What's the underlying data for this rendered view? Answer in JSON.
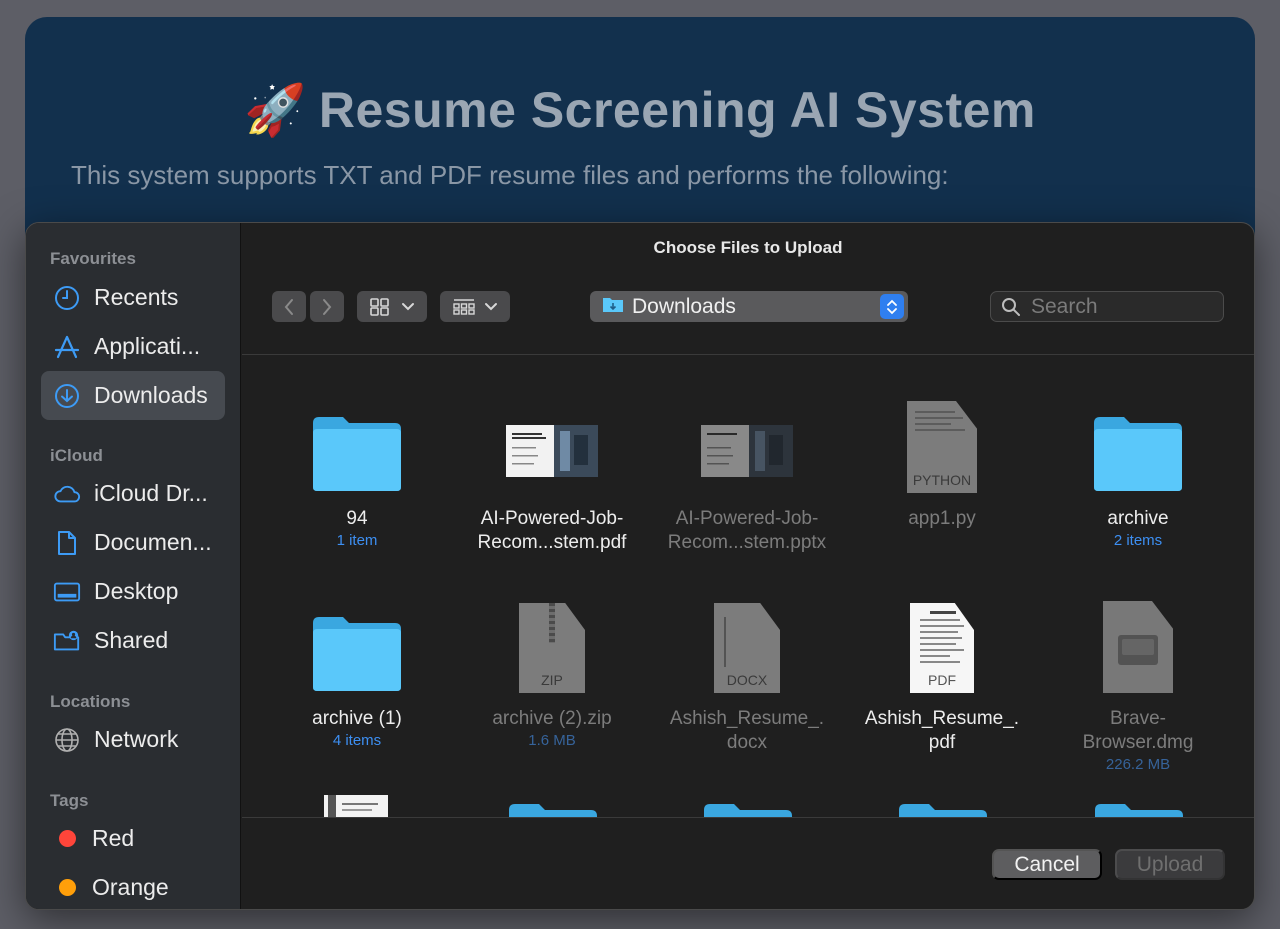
{
  "app": {
    "title": "Resume Screening AI System",
    "title_emoji": "🚀",
    "subtitle": "This system supports TXT and PDF resume files and performs the following:"
  },
  "dialog": {
    "title": "Choose Files to Upload",
    "location": "Downloads",
    "search_placeholder": "Search",
    "cancel_label": "Cancel",
    "upload_label": "Upload"
  },
  "sidebar": {
    "favourites_header": "Favourites",
    "favourites": [
      {
        "label": "Recents",
        "icon": "clock-icon"
      },
      {
        "label": "Applicati...",
        "icon": "applications-icon"
      },
      {
        "label": "Downloads",
        "icon": "download-icon",
        "selected": true
      }
    ],
    "icloud_header": "iCloud",
    "icloud": [
      {
        "label": "iCloud Dr...",
        "icon": "cloud-icon"
      },
      {
        "label": "Documen...",
        "icon": "document-icon"
      },
      {
        "label": "Desktop",
        "icon": "desktop-icon"
      },
      {
        "label": "Shared",
        "icon": "shared-folder-icon"
      }
    ],
    "locations_header": "Locations",
    "locations": [
      {
        "label": "Network",
        "icon": "globe-icon"
      }
    ],
    "tags_header": "Tags",
    "tags": [
      {
        "label": "Red",
        "color": "#ff453a"
      },
      {
        "label": "Orange",
        "color": "#ff9f0a"
      }
    ]
  },
  "files": [
    {
      "name": "94",
      "meta": "1 item",
      "kind": "folder",
      "enabled": true
    },
    {
      "name": "AI-Powered-Job-\nRecom...stem.pdf",
      "meta": "",
      "kind": "pdf-slide",
      "enabled": true
    },
    {
      "name": "AI-Powered-Job-\nRecom...stem.pptx",
      "meta": "",
      "kind": "pptx-slide",
      "enabled": false
    },
    {
      "name": "app1.py",
      "meta": "",
      "kind": "python",
      "label": "PYTHON",
      "enabled": false
    },
    {
      "name": "archive",
      "meta": "2 items",
      "kind": "folder",
      "enabled": true
    },
    {
      "name": "archive (1)",
      "meta": "4 items",
      "kind": "folder",
      "enabled": true
    },
    {
      "name": "archive (2).zip",
      "meta": "1.6 MB",
      "kind": "zip",
      "label": "ZIP",
      "enabled": false
    },
    {
      "name": "Ashish_Resume_.\ndocx",
      "meta": "",
      "kind": "docx",
      "label": "DOCX",
      "enabled": false
    },
    {
      "name": "Ashish_Resume_.\npdf",
      "meta": "",
      "kind": "pdf",
      "label": "PDF",
      "enabled": true
    },
    {
      "name": "Brave-\nBrowser.dmg",
      "meta": "226.2 MB",
      "kind": "dmg",
      "enabled": false
    }
  ],
  "colors": {
    "accent": "#2f7ff0",
    "folder": "#5ac8fa",
    "meta_blue": "#3d8ff2"
  }
}
